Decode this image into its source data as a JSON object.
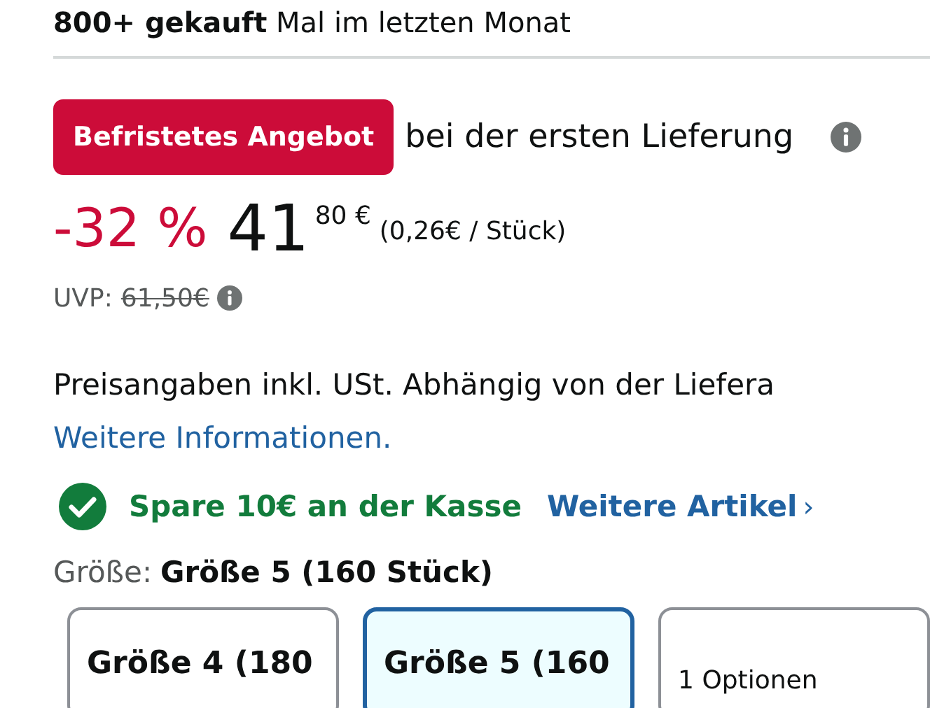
{
  "purchase_note": {
    "count": "800+ gekauft",
    "rest": "Mal im letzten Monat"
  },
  "deal": {
    "badge": "Befristetes Angebot",
    "text": "bei der ersten Lieferung"
  },
  "price": {
    "discount": "-32 %",
    "whole": "41",
    "fraction": "80 €",
    "unit_price": "(0,26€ / Stück)"
  },
  "list_price": {
    "label": "UVP:",
    "value": "61,50€"
  },
  "tax_note": "Preisangaben inkl. USt. Abhängig von der Liefera",
  "info_link": "Weitere Informationen.",
  "coupon": {
    "text": "Spare 10€ an der Kasse",
    "link": "Weitere Artikel",
    "chevron": "›"
  },
  "size": {
    "label": "Größe:",
    "value": "Größe 5 (160 Stück)"
  },
  "size_options": [
    {
      "label": "Größe 4 (180",
      "selected": false
    },
    {
      "label": "Größe 5 (160",
      "selected": true
    },
    {
      "label": "1 Optionen",
      "selected": false
    }
  ]
}
